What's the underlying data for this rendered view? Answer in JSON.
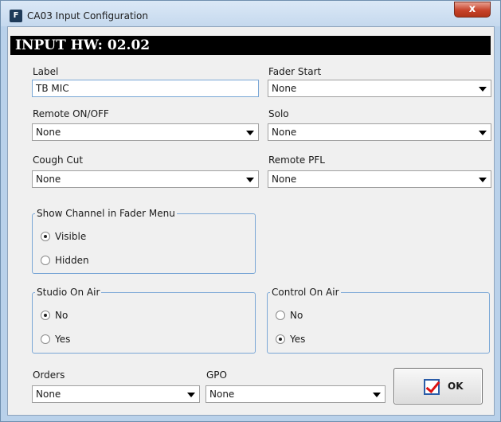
{
  "window": {
    "title": "CA03 Input Configuration",
    "app_icon_letter": "F",
    "close_label": "x"
  },
  "header": {
    "title": "INPUT HW: 02.02"
  },
  "fields": {
    "label": {
      "caption": "Label",
      "value": "TB MIC"
    },
    "fader_start": {
      "caption": "Fader Start",
      "value": "None"
    },
    "remote_onoff": {
      "caption": "Remote ON/OFF",
      "value": "None"
    },
    "solo": {
      "caption": "Solo",
      "value": "None"
    },
    "cough_cut": {
      "caption": "Cough Cut",
      "value": "None"
    },
    "remote_pfl": {
      "caption": "Remote PFL",
      "value": "None"
    },
    "orders": {
      "caption": "Orders",
      "value": "None"
    },
    "gpo": {
      "caption": "GPO",
      "value": "None"
    }
  },
  "groups": {
    "show_channel": {
      "title": "Show Channel in Fader Menu",
      "options": [
        {
          "label": "Visible",
          "checked": true
        },
        {
          "label": "Hidden",
          "checked": false
        }
      ]
    },
    "studio_on_air": {
      "title": "Studio On Air",
      "options": [
        {
          "label": "No",
          "checked": true
        },
        {
          "label": "Yes",
          "checked": false
        }
      ]
    },
    "control_on_air": {
      "title": "Control On Air",
      "options": [
        {
          "label": "No",
          "checked": false
        },
        {
          "label": "Yes",
          "checked": true
        }
      ]
    }
  },
  "buttons": {
    "ok_label": "OK"
  },
  "colors": {
    "header_bg": "#000000",
    "group_border": "#7aa7d6",
    "frame": "#b9d1ea"
  }
}
